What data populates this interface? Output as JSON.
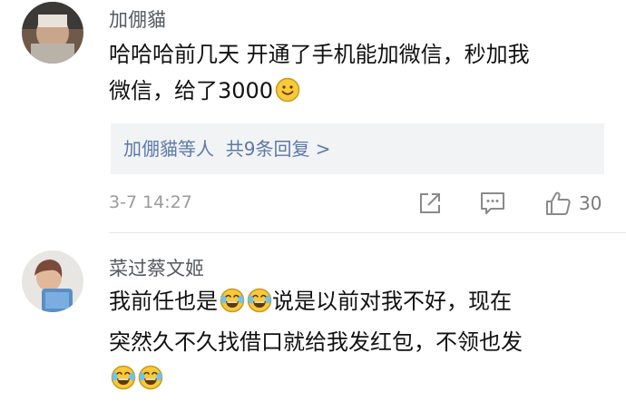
{
  "comments": [
    {
      "username": "加倗貓",
      "content_line1": "哈哈哈前几天 开通了手机能加微信，秒加我",
      "content_line2": "微信，给了3000",
      "emoji_icon": "smile-emoji",
      "replies_label": "加倗貓等人",
      "replies_count": "共9条回复 >",
      "time": "3-7 14:27",
      "like_count": "30",
      "icons": [
        "share-icon",
        "comment-icon",
        "thumbs-up-icon"
      ]
    },
    {
      "username": "菜过蔡文姬",
      "content_line1a": "我前任也是",
      "content_line1b": "说是以前对我不好，现在",
      "content_line2": "突然久不久找借口就给我发红包，不领也发",
      "emoji_icon": "laugh-cry-emoji"
    }
  ],
  "colors": {
    "link": "#5b7aa8",
    "meta": "#9b9b9b",
    "reply_bg": "#f2f3f5",
    "emoji_yellow": "#f9c93c"
  }
}
